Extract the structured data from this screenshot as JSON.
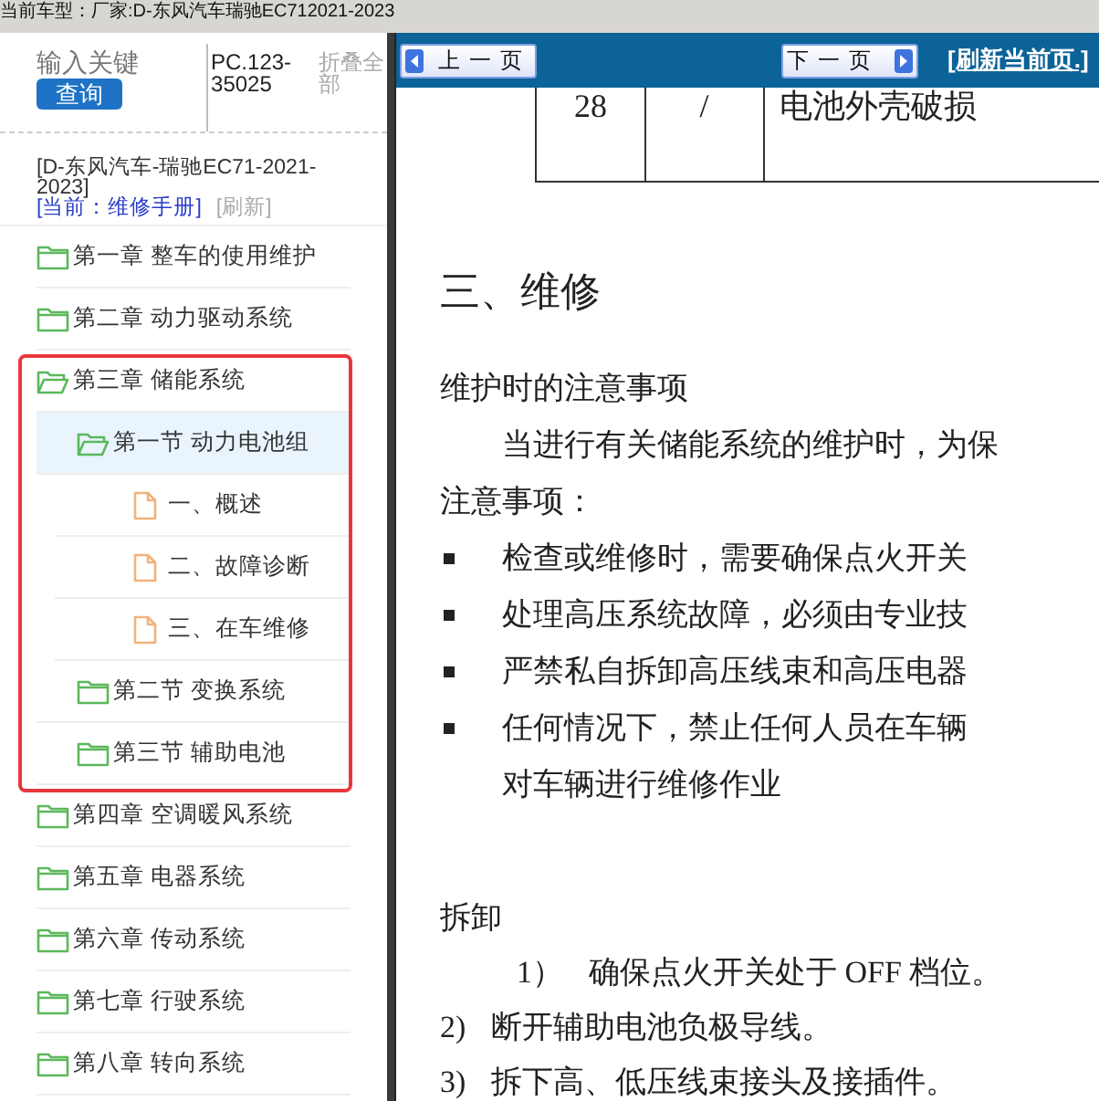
{
  "top_bar": {
    "vehicle_label": "当前车型：厂家:D-东风汽车瑞驰EC712021-2023"
  },
  "sidebar": {
    "search": {
      "placeholder": "输入关键"
    },
    "search_button": "查询",
    "part_code": "PC.123-35025",
    "collapse_all": "折叠全部",
    "vehicle": "[D-东风汽车-瑞驰EC71-2021-2023]",
    "current_manual": "[当前：维修手册]",
    "refresh": "[刷新]",
    "tree": [
      {
        "label": "第一章 整车的使用维护",
        "kind": "folder",
        "expanded": false,
        "selected": false,
        "highlighted": false
      },
      {
        "label": "第二章 动力驱动系统",
        "kind": "folder",
        "expanded": false,
        "selected": false,
        "highlighted": false
      },
      {
        "label": "第三章 储能系统",
        "kind": "folder",
        "expanded": true,
        "selected": false,
        "highlighted": true,
        "children": [
          {
            "label": "第一节 动力电池组",
            "kind": "folder",
            "expanded": true,
            "selected": true,
            "children": [
              {
                "label": "一、概述",
                "kind": "document",
                "selected": false
              },
              {
                "label": "二、故障诊断",
                "kind": "document",
                "selected": false
              },
              {
                "label": "三、在车维修",
                "kind": "document",
                "selected": false
              }
            ]
          },
          {
            "label": "第二节 变换系统",
            "kind": "folder",
            "expanded": false,
            "selected": false
          },
          {
            "label": "第三节 辅助电池",
            "kind": "folder",
            "expanded": false,
            "selected": false
          }
        ]
      },
      {
        "label": "第四章 空调暖风系统",
        "kind": "folder",
        "expanded": false,
        "selected": false,
        "highlighted": false
      },
      {
        "label": "第五章 电器系统",
        "kind": "folder",
        "expanded": false,
        "selected": false,
        "highlighted": false
      },
      {
        "label": "第六章 传动系统",
        "kind": "folder",
        "expanded": false,
        "selected": false,
        "highlighted": false
      },
      {
        "label": "第七章 行驶系统",
        "kind": "folder",
        "expanded": false,
        "selected": false,
        "highlighted": false
      },
      {
        "label": "第八章 转向系统",
        "kind": "folder",
        "expanded": false,
        "selected": false,
        "highlighted": false
      }
    ]
  },
  "toolbar": {
    "prev": "上一页",
    "next": "下一页",
    "refresh": "[刷新当前页.]"
  },
  "document": {
    "table_row": [
      "28",
      "/",
      "电池外壳破损"
    ],
    "heading": "三、维修",
    "subheading": "维护时的注意事项",
    "paragraph": "当进行有关储能系统的维护时，为保",
    "note_title": "注意事项：",
    "bullets": [
      "检查或维修时，需要确保点火开关",
      "处理高压系统故障，必须由专业技",
      "严禁私自拆卸高压线束和高压电器",
      "任何情况下，禁止任何人员在车辆"
    ],
    "continuation": "对车辆进行维修作业",
    "section": "拆卸",
    "steps": [
      {
        "number": "1）",
        "text": "确保点火开关处于 OFF 档位。",
        "indented": true
      },
      {
        "number": "2)",
        "text": "断开辅助电池负极导线。",
        "indented": false
      },
      {
        "number": "3)",
        "text": "拆下高、低压线束接头及接插件。",
        "indented": false
      }
    ]
  }
}
